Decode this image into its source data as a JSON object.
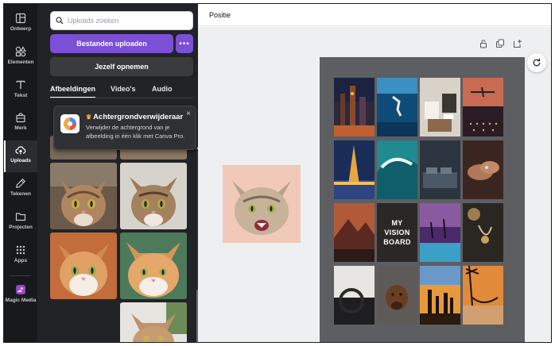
{
  "rail": {
    "items": [
      {
        "label": "Ontwerp",
        "icon": "layout-icon"
      },
      {
        "label": "Elementen",
        "icon": "shapes-icon"
      },
      {
        "label": "Tekst",
        "icon": "text-icon"
      },
      {
        "label": "Merk",
        "icon": "brand-icon"
      },
      {
        "label": "Uploads",
        "icon": "upload-cloud-icon"
      },
      {
        "label": "Tekenen",
        "icon": "pen-icon"
      },
      {
        "label": "Projecten",
        "icon": "folder-icon"
      },
      {
        "label": "Apps",
        "icon": "apps-grid-icon"
      },
      {
        "label": "Magic Media",
        "icon": "magic-media-icon"
      }
    ],
    "active": "Uploads"
  },
  "panel": {
    "search_placeholder": "Uploads zoeken",
    "upload_button": "Bestanden uploaden",
    "more_button": "•••",
    "record_button": "Jezelf opnemen",
    "tabs": [
      {
        "label": "Afbeeldingen",
        "active": true
      },
      {
        "label": "Video's",
        "active": false
      },
      {
        "label": "Audio",
        "active": false
      }
    ]
  },
  "popup": {
    "title": "Achtergrondverwijderaar",
    "text": "Verwijder de achtergrond van je afbeelding in één klik met Canva Pro.",
    "close": "×"
  },
  "topbar": {
    "title": "Positie"
  },
  "board": {
    "center_text_line1": "MY",
    "center_text_line2": "VISION",
    "center_text_line3": "BOARD"
  },
  "colors": {
    "accent": "#7b4fd6",
    "rail_bg": "#18191b",
    "panel_bg": "#222326",
    "canvas_bg": "#eeeff1",
    "board_bg": "#5d5e61"
  }
}
